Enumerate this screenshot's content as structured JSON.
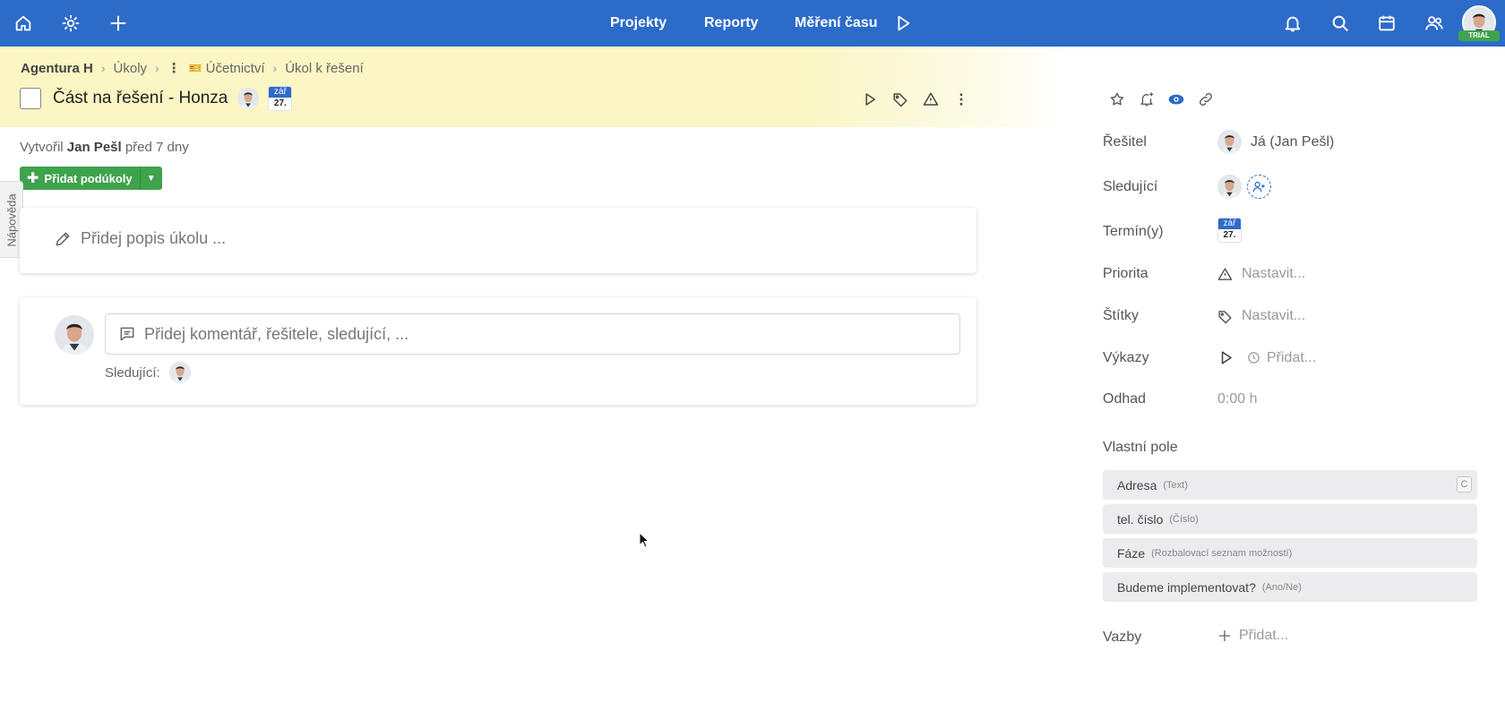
{
  "topbar": {
    "nav": [
      {
        "label": "Projekty"
      },
      {
        "label": "Reporty"
      },
      {
        "label": "Měření času"
      }
    ],
    "trial_badge": "TRIAL",
    "accent_color": "#2d6bc9"
  },
  "breadcrumb": {
    "items": [
      "Agentura H",
      "Úkoly",
      "Účetnictví",
      "Úkol k řešení"
    ]
  },
  "task": {
    "title": "Část na řešení - Honza",
    "date_month": "zář",
    "date_day": "27."
  },
  "meta": {
    "created_prefix": "Vytvořil",
    "created_by": "Jan Pešl",
    "created_when": "před 7 dny"
  },
  "subtasks": {
    "add_label": "Přidat podúkoly"
  },
  "help_tab": "Nápověda",
  "description": {
    "placeholder": "Přidej popis úkolu ..."
  },
  "comment": {
    "placeholder": "Přidej komentář, řešitele, sledující, ...",
    "followers_label": "Sledující:"
  },
  "sidebar": {
    "resitel": {
      "label": "Řešitel",
      "value": "Já (Jan Pešl)"
    },
    "sledujici": {
      "label": "Sledující"
    },
    "terminy": {
      "label": "Termín(y)",
      "month": "zář",
      "day": "27."
    },
    "priorita": {
      "label": "Priorita",
      "value": "Nastavit..."
    },
    "stitky": {
      "label": "Štítky",
      "value": "Nastavit..."
    },
    "vykazy": {
      "label": "Výkazy",
      "value": "Přidat..."
    },
    "odhad": {
      "label": "Odhad",
      "value": "0:00 h"
    },
    "custom_fields_title": "Vlastní pole",
    "custom_fields": [
      {
        "name": "Adresa",
        "type": "(Text)",
        "key": "C"
      },
      {
        "name": "tel. číslo",
        "type": "(Číslo)"
      },
      {
        "name": "Fáze",
        "type": "(Rozbalovací seznam možností)"
      },
      {
        "name": "Budeme implementovat?",
        "type": "(Ano/Ne)"
      }
    ],
    "vazby": {
      "label": "Vazby",
      "value": "Přidat..."
    }
  }
}
